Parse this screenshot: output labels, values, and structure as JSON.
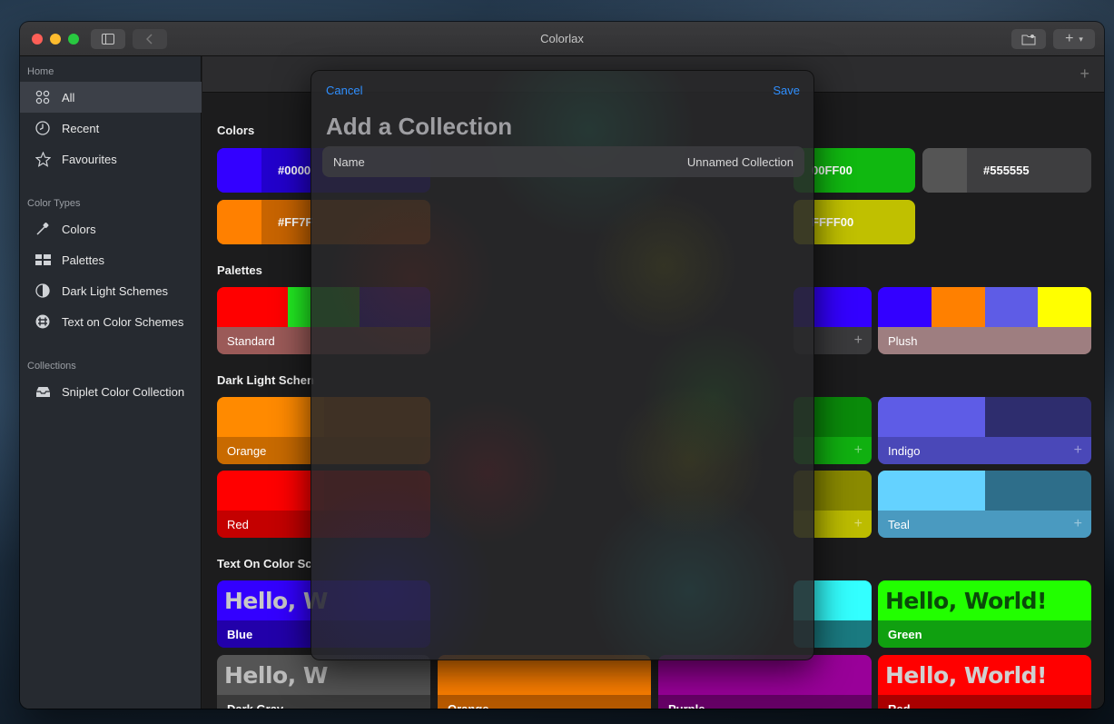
{
  "window": {
    "title": "Colorlax"
  },
  "sidebar": {
    "sections": [
      {
        "label": "Home"
      },
      {
        "label": "Color Types"
      },
      {
        "label": "Collections"
      }
    ],
    "items": [
      {
        "label": "All",
        "icon": "grid-icon"
      },
      {
        "label": "Recent",
        "icon": "clock-icon"
      },
      {
        "label": "Favourites",
        "icon": "star-icon"
      },
      {
        "label": "Colors",
        "icon": "eyedropper-icon"
      },
      {
        "label": "Palettes",
        "icon": "palette-icon"
      },
      {
        "label": "Dark Light Schemes",
        "icon": "half-circle-icon"
      },
      {
        "label": "Text on Color Schemes",
        "icon": "text-circle-icon"
      },
      {
        "label": "Sniplet Color Collection",
        "icon": "tray-icon"
      }
    ]
  },
  "main": {
    "sections": {
      "colors": "Colors",
      "palettes": "Palettes",
      "dark_light": "Dark Light Schen",
      "text_on_color": "Text On Color Sc"
    },
    "colors": [
      {
        "label": "#0000",
        "swatch": "#3300ff",
        "bg": "#2200cc"
      },
      {
        "label": "00FF00",
        "swatch": "#10c010",
        "bg": "#10b810"
      },
      {
        "label": "#555555",
        "swatch": "#555555",
        "bg": "#3e3e40"
      },
      {
        "label": "#FF7F",
        "swatch": "#ff8000",
        "bg": "#c86400"
      },
      {
        "label": "FFFF00",
        "swatch": "#d8d800",
        "bg": "#c0c000"
      }
    ],
    "palettes": [
      {
        "label": "Standard",
        "colors": [
          "#ff0000",
          "#22ee22",
          "#3300ff"
        ],
        "labelbg": "#9b5a58"
      },
      {
        "label": "",
        "colors": [
          "#3300ff"
        ],
        "labelbg": "#3a3a3c"
      },
      {
        "label": "Plush",
        "colors": [
          "#3300ff",
          "#ff8000",
          "#5e5ce6",
          "#ffff00"
        ],
        "labelbg": "#9e7e80"
      }
    ],
    "dark_light": [
      {
        "label": "Orange",
        "c1": "#ff8a00",
        "c2": "#e07400",
        "labelbg": "#c86a00"
      },
      {
        "label": "",
        "c1": "#0a8a0a",
        "c2": "#0a8a0a",
        "labelbg": "#10b010"
      },
      {
        "label": "Indigo",
        "c1": "#5e5ce6",
        "c2": "#2e2d6e",
        "labelbg": "#4a48b8"
      },
      {
        "label": "Red",
        "c1": "#ff0000",
        "c2": "#e00000",
        "labelbg": "#c40000"
      },
      {
        "label": "",
        "c1": "#8a8a00",
        "c2": "#8a8a00",
        "labelbg": "#bcbc00"
      },
      {
        "label": "Teal",
        "c1": "#64d2ff",
        "c2": "#2e6e8a",
        "labelbg": "#4a9ac0"
      }
    ],
    "text_on_color": [
      {
        "label": "Blue",
        "text": "Hello, W",
        "bg": "#3300ff",
        "fg": "#c8c8c8",
        "labelbg": "#2200aa"
      },
      {
        "label": "",
        "text": "",
        "bg": "#33ffff",
        "fg": "#1a6666",
        "labelbg": "#1a7a80"
      },
      {
        "label": "Green",
        "text": "Hello, World!",
        "bg": "#22ff00",
        "fg": "#0a4a0a",
        "labelbg": "#10a010"
      },
      {
        "label": "Dark Gray",
        "text": "Hello, W",
        "bg": "#555555",
        "fg": "#bdbdbd",
        "labelbg": "#3a3a3a"
      },
      {
        "label": "Orange",
        "text": "",
        "bg": "#ff8000",
        "fg": "#663300",
        "labelbg": "#b85a00"
      },
      {
        "label": "Purple",
        "text": "",
        "bg": "#990099",
        "fg": "#330033",
        "labelbg": "#660066"
      },
      {
        "label": "Red",
        "text": "Hello, World!",
        "bg": "#ff0000",
        "fg": "#d0d0d0",
        "labelbg": "#aa0000"
      }
    ]
  },
  "modal": {
    "cancel_label": "Cancel",
    "save_label": "Save",
    "title": "Add a Collection",
    "name_label": "Name",
    "name_value": "Unnamed Collection"
  }
}
